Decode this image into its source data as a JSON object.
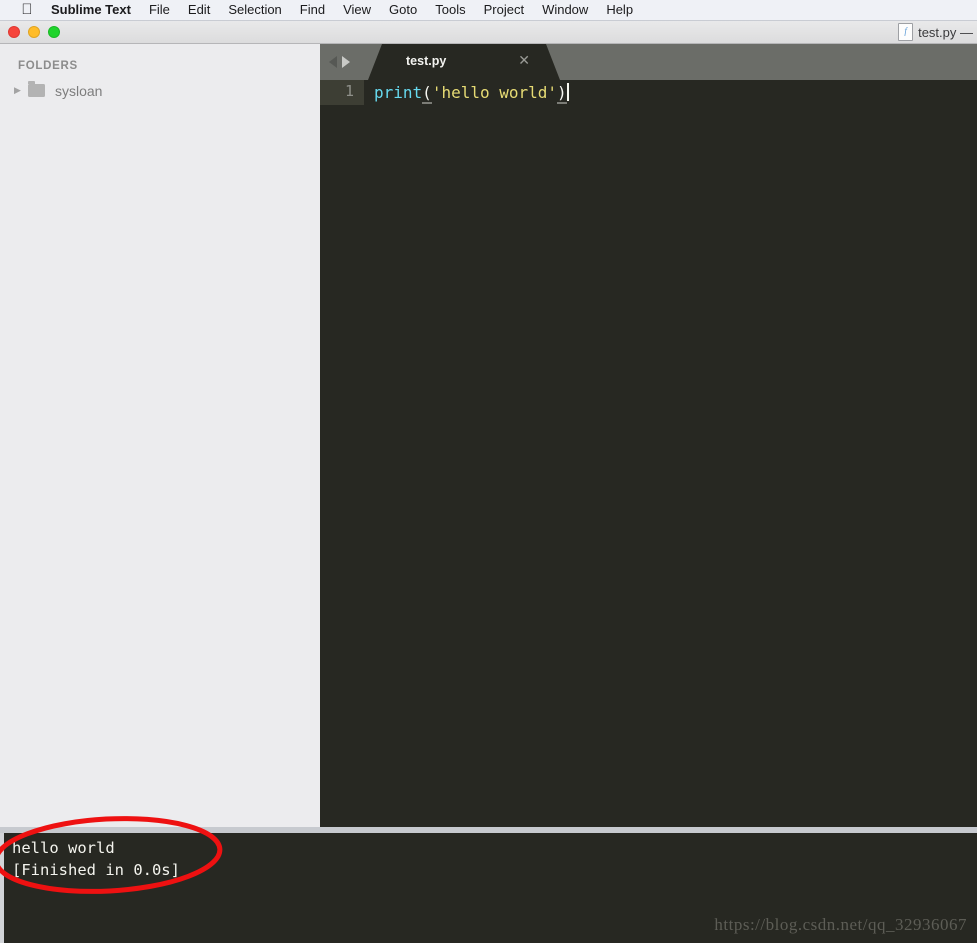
{
  "menubar": {
    "apple_icon": "apple-logo-icon",
    "items": [
      {
        "label": "Sublime Text",
        "bold": true
      },
      {
        "label": "File"
      },
      {
        "label": "Edit"
      },
      {
        "label": "Selection"
      },
      {
        "label": "Find"
      },
      {
        "label": "View"
      },
      {
        "label": "Goto"
      },
      {
        "label": "Tools"
      },
      {
        "label": "Project"
      },
      {
        "label": "Window"
      },
      {
        "label": "Help"
      }
    ]
  },
  "titlebar": {
    "title": "test.py —",
    "doc_icon_glyph": "f",
    "traffic_lights": {
      "close_color": "#f6443b",
      "minimize_color": "#ffbc29",
      "maximize_color": "#1fd42c"
    }
  },
  "sidebar": {
    "header": "FOLDERS",
    "tree": [
      {
        "label": "sysloan",
        "disclosure": "▶",
        "expanded": false
      }
    ]
  },
  "editor": {
    "tab": {
      "label": "test.py",
      "close_glyph": "✕"
    },
    "nav_back_icon": "arrow-left-icon",
    "nav_forward_icon": "arrow-forward-icon",
    "line_number": "1",
    "code": {
      "full_text": "print('hello world')",
      "tokens": [
        {
          "text": "print",
          "type": "function"
        },
        {
          "text": "(",
          "type": "paren-open"
        },
        {
          "text": "'hello world'",
          "type": "string"
        },
        {
          "text": ")",
          "type": "paren-close"
        }
      ]
    }
  },
  "console": {
    "lines": "hello world\n[Finished in 0.0s]",
    "line1": "hello world",
    "line2": "[Finished in 0.0s]"
  },
  "watermark": {
    "text": "https://blog.csdn.net/qq_32936067"
  },
  "annotation": {
    "shape": "ellipse",
    "color": "#ee1111",
    "stroke_width": 5
  },
  "colors": {
    "menubar_bg": "#eff1f6",
    "titlebar_bg": "#e3e3e4",
    "sidebar_bg": "#ececee",
    "editor_bg": "#272822",
    "tabbar_bg": "#6b6d68",
    "console_bg": "#272822",
    "keyword_cyan": "#66d9ef",
    "string_yellow": "#e6db74"
  }
}
